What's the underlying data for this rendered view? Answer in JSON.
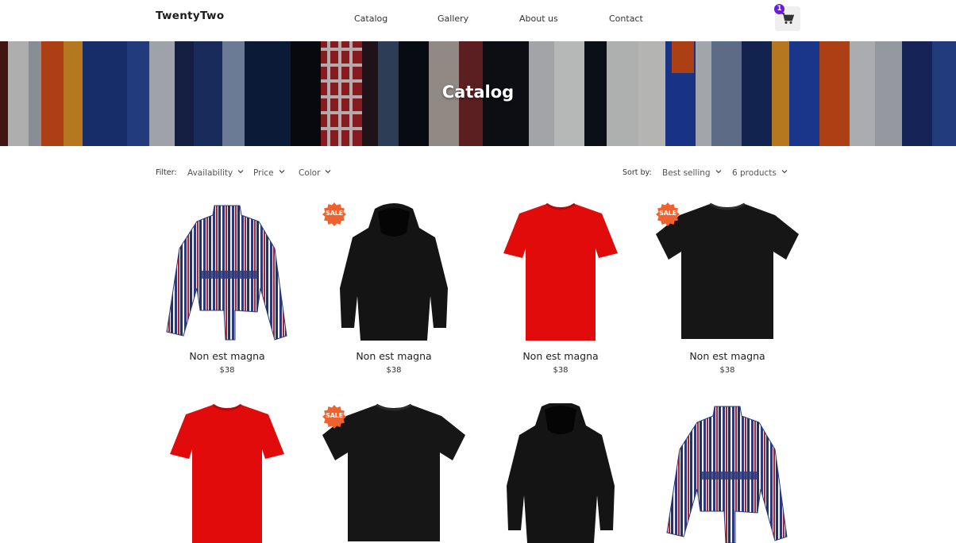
{
  "brand": "TwentyTwo",
  "nav": [
    {
      "label": "Catalog"
    },
    {
      "label": "Gallery"
    },
    {
      "label": "About us"
    },
    {
      "label": "Contact"
    }
  ],
  "cart": {
    "count": "1",
    "icon": "cart-icon"
  },
  "hero": {
    "title": "Catalog"
  },
  "filters": {
    "label": "Filter:",
    "options": [
      "Availability",
      "Price",
      "Color"
    ],
    "sort_label": "Sort by:",
    "sort_value": "Best selling",
    "count_value": "6 products"
  },
  "sale_label": "SALE",
  "colors": {
    "accent": "#6a1be0",
    "sale": "#f0622d",
    "shirt_red": "#e20b0b"
  },
  "products": [
    {
      "name": "Non est magna",
      "price": "$38",
      "image": "striped-blouse",
      "sale": false
    },
    {
      "name": "Non est magna",
      "price": "$38",
      "image": "black-hoodie",
      "sale": true
    },
    {
      "name": "Non est magna",
      "price": "$38",
      "image": "red-tshirt",
      "sale": false
    },
    {
      "name": "Non est magna",
      "price": "$38",
      "image": "black-tshirt",
      "sale": true
    },
    {
      "name": "",
      "price": "",
      "image": "red-tshirt",
      "sale": false
    },
    {
      "name": "",
      "price": "",
      "image": "black-tshirt",
      "sale": true
    },
    {
      "name": "",
      "price": "",
      "image": "black-hoodie",
      "sale": false
    },
    {
      "name": "",
      "price": "",
      "image": "striped-blouse",
      "sale": false
    }
  ]
}
